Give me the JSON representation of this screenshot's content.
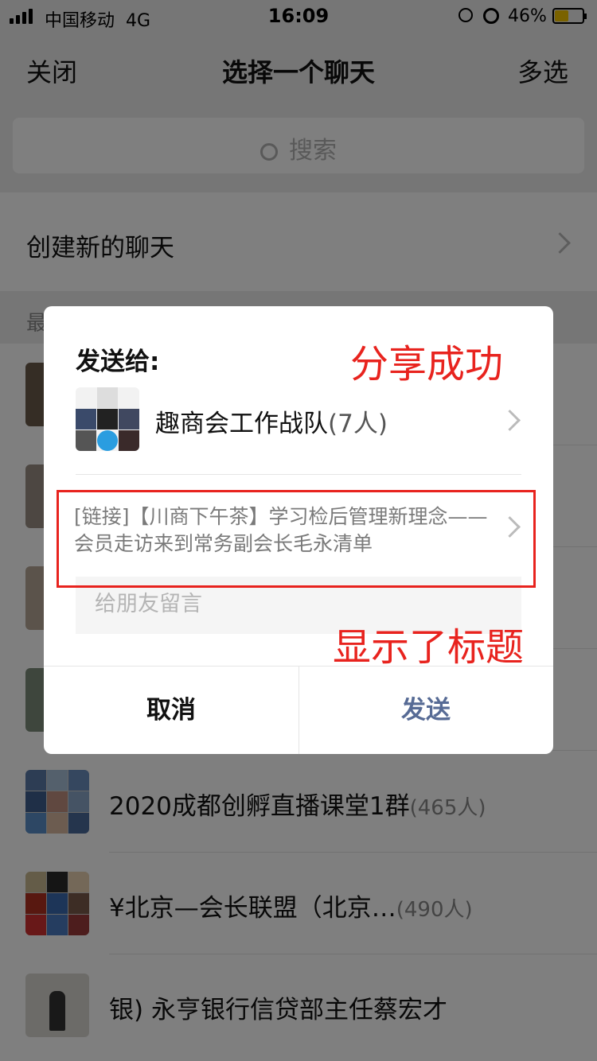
{
  "status_bar": {
    "carrier": "中国移动",
    "network": "4G",
    "time": "16:09",
    "battery": "46%"
  },
  "nav": {
    "close": "关闭",
    "title": "选择一个聊天",
    "multi_select": "多选"
  },
  "search": {
    "placeholder": "搜索"
  },
  "create_new_chat": "创建新的聊天",
  "recent_label": "最",
  "chats": [
    {
      "name": "2020成都创孵直播课堂1群",
      "count": "(465人)"
    },
    {
      "name": "¥北京—会长联盟（北京…",
      "count": "(490人)"
    },
    {
      "name": "银) 永亨银行信贷部主任蔡宏才",
      "count": ""
    }
  ],
  "dialog": {
    "send_to_label": "发送给:",
    "group_name": "趣商会工作战队",
    "group_count": "(7人)",
    "link_text": "[链接]【川商下午茶】学习检后管理新理念——会员走访来到常务副会长毛永清单",
    "message_placeholder": "给朋友留言",
    "cancel": "取消",
    "send": "发送"
  },
  "annotations": {
    "share_success": "分享成功",
    "title_shown": "显示了标题",
    "color": "#e8231e"
  },
  "colors": {
    "send_button": "#576b95",
    "background": "#ededed"
  }
}
